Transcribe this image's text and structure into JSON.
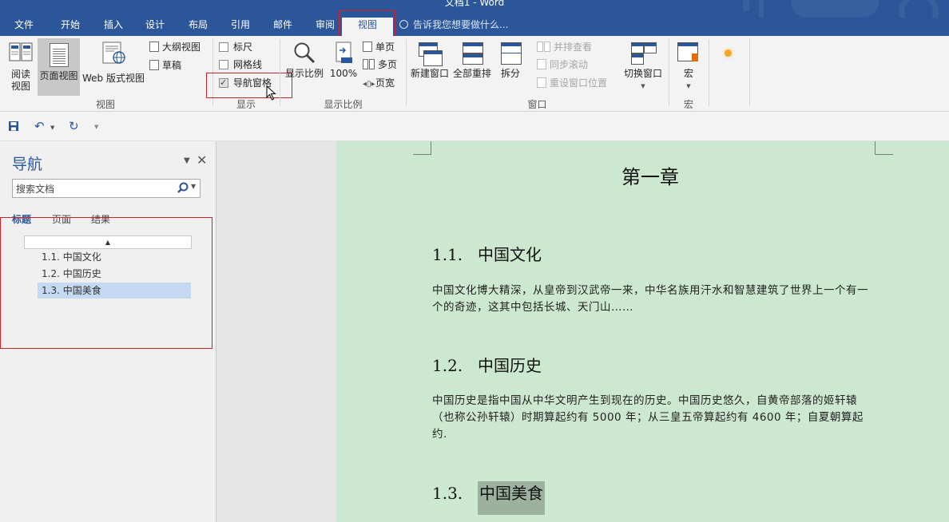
{
  "window": {
    "title": "文档1 - Word"
  },
  "menu_tabs": [
    "文件",
    "开始",
    "插入",
    "设计",
    "布局",
    "引用",
    "邮件",
    "审阅",
    "视图"
  ],
  "active_tab": "视图",
  "tell_me": "告诉我您想要做什么...",
  "ribbon": {
    "views": {
      "read_mode": "阅读\n视图",
      "print_layout": "页面视图",
      "web_layout": "Web 版式视图",
      "outline": "大纲视图",
      "draft": "草稿",
      "group_label": "视图"
    },
    "show": {
      "ruler": "标尺",
      "gridlines": "网格线",
      "navigation_pane": "导航窗格",
      "group_label": "显示"
    },
    "zoom": {
      "zoom": "显示比例",
      "percent": "100%",
      "one_page": "单页",
      "multiple_pages": "多页",
      "page_width": "页宽",
      "group_label": "显示比例"
    },
    "window": {
      "new_window": "新建窗口",
      "arrange_all": "全部重排",
      "split": "拆分",
      "side_by_side": "并排查看",
      "sync_scroll": "同步滚动",
      "reset_position": "重设窗口位置",
      "switch_windows": "切换窗口",
      "group_label": "窗口"
    },
    "macros": {
      "macros": "宏",
      "group_label": "宏"
    }
  },
  "nav_pane": {
    "title": "导航",
    "search_placeholder": "搜索文档",
    "tabs": [
      "标题",
      "页面",
      "结果"
    ],
    "headings": [
      "1.1. 中国文化",
      "1.2. 中国历史",
      "1.3. 中国美食"
    ],
    "selected_heading_index": 2
  },
  "document": {
    "chapter_title": "第一章",
    "sections": [
      {
        "num": "1.1.",
        "title": "中国文化",
        "body": "中国文化博大精深，从皇帝到汉武帝一来，中华名族用汗水和智慧建筑了世界上一个有一个的奇迹，这其中包括长城、天门山……"
      },
      {
        "num": "1.2.",
        "title": "中国历史",
        "body": "中国历史是指中国从中华文明产生到现在的历史。中国历史悠久，自黄帝部落的姬轩辕（也称公孙轩辕）时期算起约有 5000 年；从三皇五帝算起约有 4600 年；自夏朝算起约."
      },
      {
        "num": "1.3.",
        "title": "中国美食"
      }
    ]
  },
  "colors": {
    "accent": "#2b579a",
    "page_bg": "#cde8d0",
    "highlight": "#9cb19e",
    "annotation": "#d0202a"
  }
}
